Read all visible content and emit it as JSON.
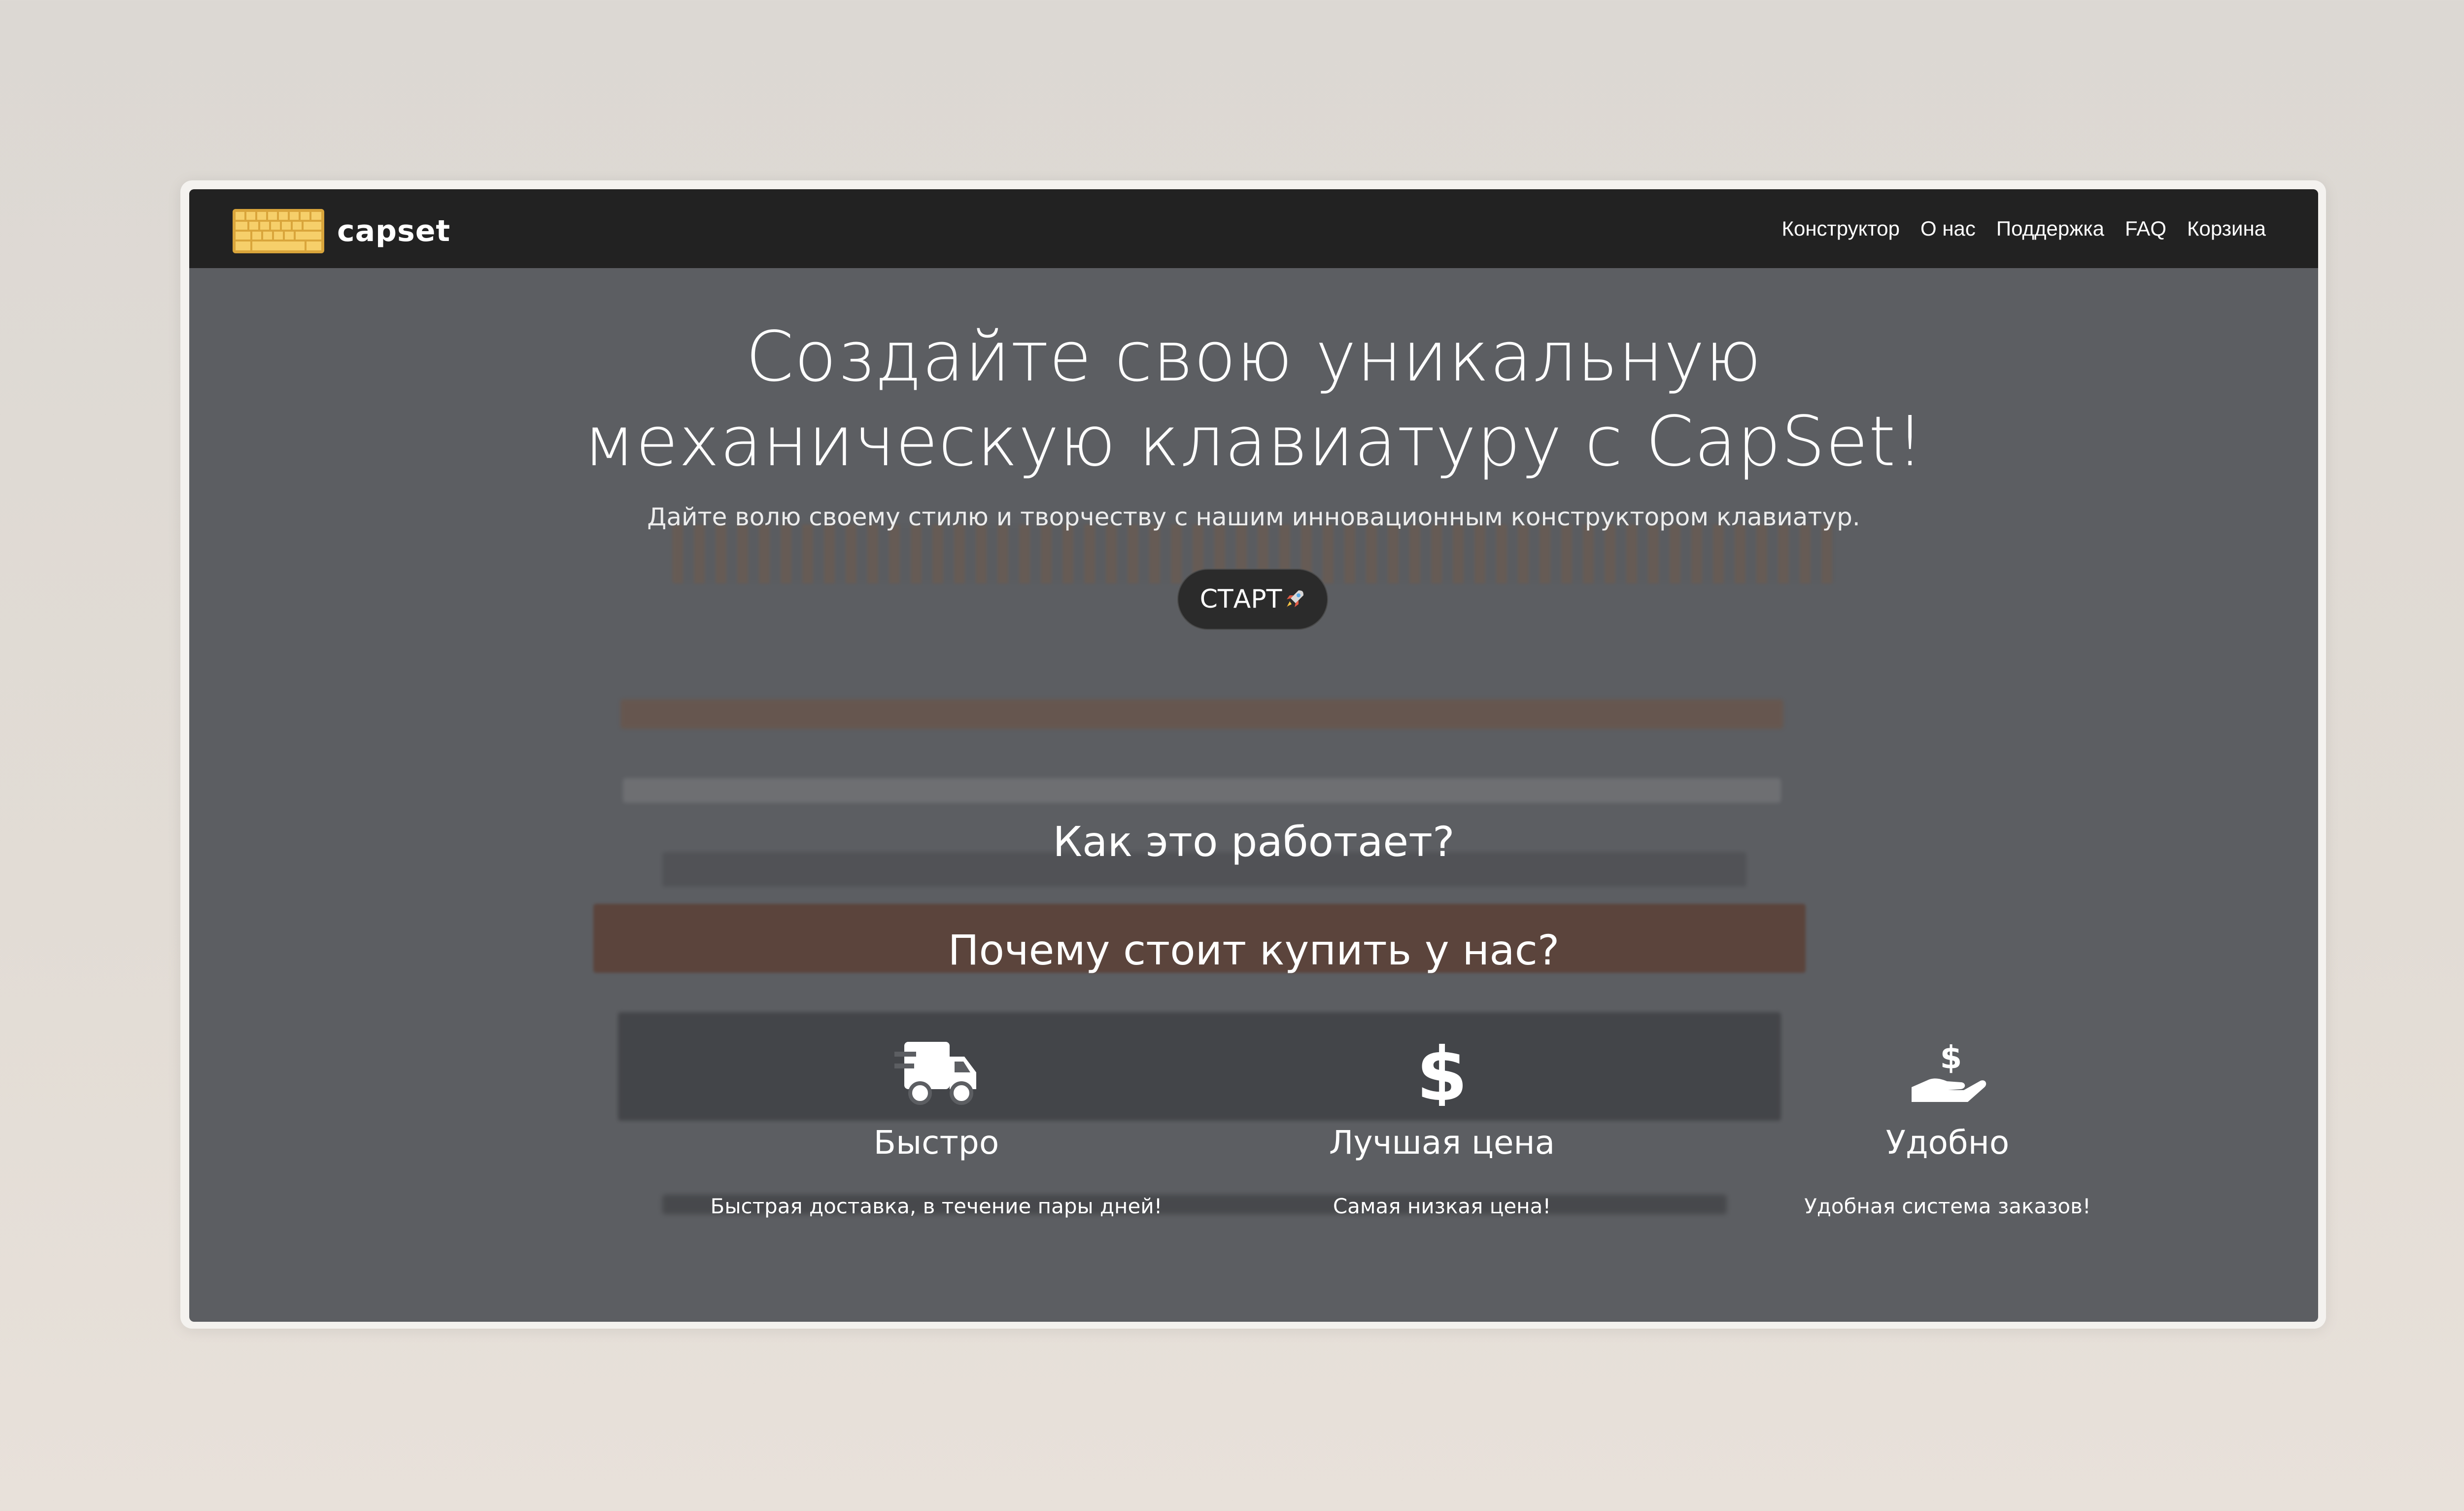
{
  "brand": {
    "name": "capset",
    "logo_color": "#f2c14e"
  },
  "nav": {
    "items": [
      {
        "label": "Конструктор"
      },
      {
        "label": "О нас"
      },
      {
        "label": "Поддержка"
      },
      {
        "label": "FAQ"
      },
      {
        "label": "Корзина"
      }
    ]
  },
  "hero": {
    "title_line1": "Создайте свою уникальную",
    "title_line2": "механическую клавиатуру с CapSet!",
    "subtitle": "Дайте волю своему стилю и творчеству с нашим инновационным конструктором клавиатур.",
    "start_label": "СТАРТ",
    "start_icon": "rocket-icon"
  },
  "sections": {
    "how_it_works": "Как это работает?",
    "why_us": "Почему стоит купить у нас?"
  },
  "features": [
    {
      "icon": "truck-icon",
      "title": "Быстро",
      "desc": "Быстрая доставка, в течение пары дней!"
    },
    {
      "icon": "dollar-icon",
      "title": "Лучшая цена",
      "desc": "Самая низкая цена!"
    },
    {
      "icon": "hand-money-icon",
      "title": "Удобно",
      "desc": "Удобная система заказов!"
    }
  ],
  "colors": {
    "navbar": "#222222",
    "hero_overlay": "#5c5e62",
    "accent": "#f2c14e"
  }
}
